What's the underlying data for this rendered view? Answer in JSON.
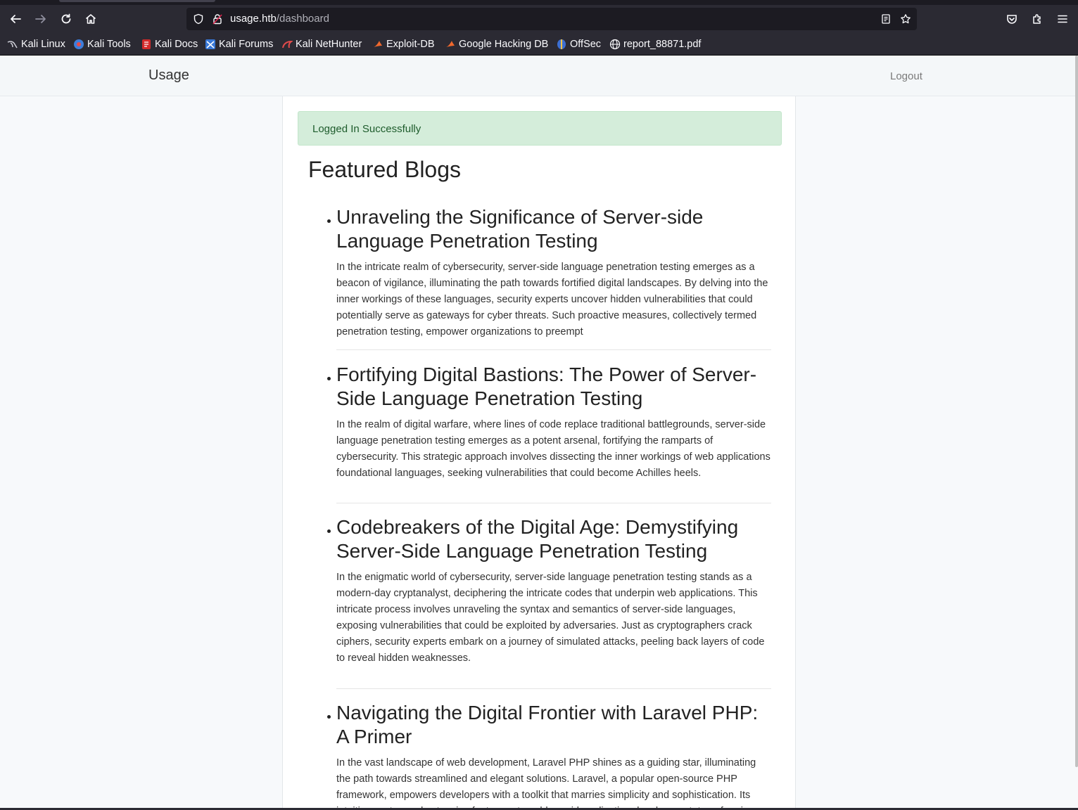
{
  "browser": {
    "url_host": "usage.htb",
    "url_path": "/dashboard",
    "bookmarks": [
      {
        "label": "Kali Linux",
        "icon": "kali-dragon-icon"
      },
      {
        "label": "Kali Tools",
        "icon": "kali-tools-icon"
      },
      {
        "label": "Kali Docs",
        "icon": "kali-docs-icon"
      },
      {
        "label": "Kali Forums",
        "icon": "kali-forums-icon"
      },
      {
        "label": "Kali NetHunter",
        "icon": "kali-nethunter-icon"
      },
      {
        "label": "Exploit-DB",
        "icon": "exploit-db-icon"
      },
      {
        "label": "Google Hacking DB",
        "icon": "ghdb-icon"
      },
      {
        "label": "OffSec",
        "icon": "offsec-icon"
      },
      {
        "label": "report_88871.pdf",
        "icon": "globe-icon"
      }
    ]
  },
  "navbar": {
    "brand": "Usage",
    "logout": "Logout"
  },
  "alert": {
    "message": "Logged In Successfully",
    "color": "#d4edda"
  },
  "main": {
    "heading": "Featured Blogs",
    "blogs": [
      {
        "title": "Unraveling the Significance of Server-side Language Penetration Testing",
        "text": "In the intricate realm of cybersecurity, server-side language penetration testing emerges as a beacon of vigilance, illuminating the path towards fortified digital landscapes. By delving into the inner workings of these languages, security experts uncover hidden vulnerabilities that could potentially serve as gateways for cyber threats. Such proactive measures, collectively termed penetration testing, empower organizations to preempt"
      },
      {
        "title": "Fortifying Digital Bastions: The Power of Server-Side Language Penetration Testing",
        "text": "In the realm of digital warfare, where lines of code replace traditional battlegrounds, server-side language penetration testing emerges as a potent arsenal, fortifying the ramparts of cybersecurity. This strategic approach involves dissecting the inner workings of web applications foundational languages, seeking vulnerabilities that could become Achilles heels."
      },
      {
        "title": "Codebreakers of the Digital Age: Demystifying Server-Side Language Penetration Testing",
        "text": "In the enigmatic world of cybersecurity, server-side language penetration testing stands as a modern-day cryptanalyst, deciphering the intricate codes that underpin web applications. This intricate process involves unraveling the syntax and semantics of server-side languages, exposing vulnerabilities that could be exploited by adversaries. Just as cryptographers crack ciphers, security experts embark on a journey of simulated attacks, peeling back layers of code to reveal hidden weaknesses."
      },
      {
        "title": "Navigating the Digital Frontier with Laravel PHP: A Primer",
        "text": "In the vast landscape of web development, Laravel PHP shines as a guiding star, illuminating the path towards streamlined and elegant solutions. Laravel, a popular open-source PHP framework, empowers developers with a toolkit that marries simplicity and sophistication. Its intuitive syntax and extensive feature set enable rapid application development, transforming complex coding tasks into graceful choreography."
      }
    ]
  }
}
